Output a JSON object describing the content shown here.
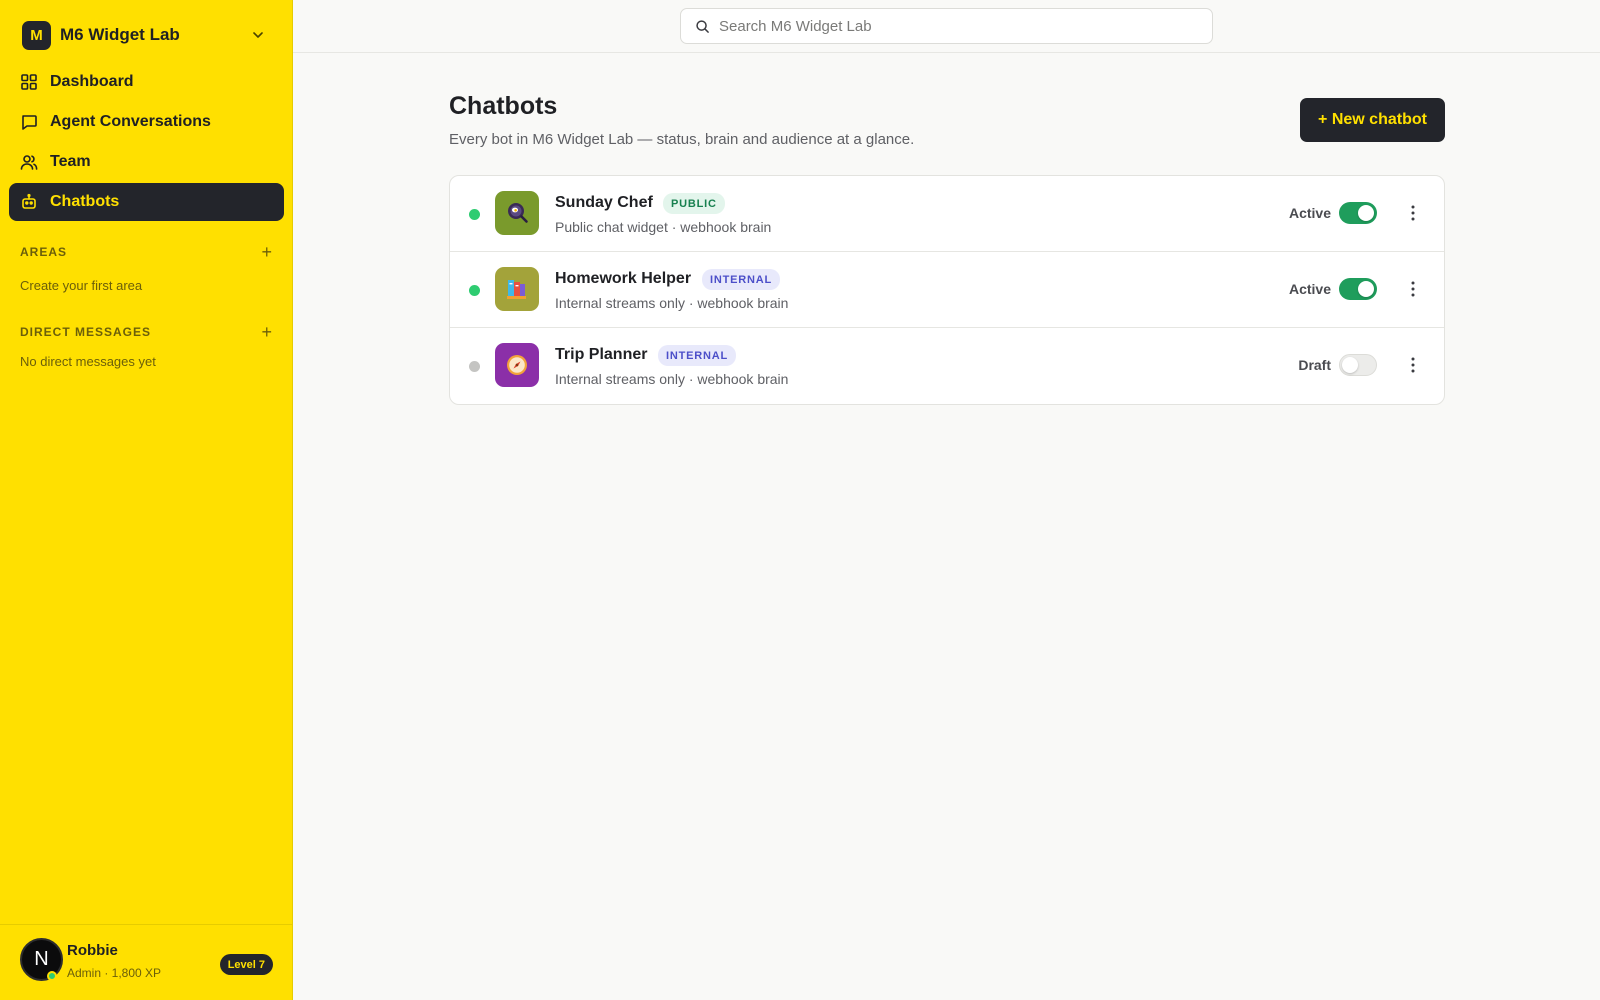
{
  "workspace": {
    "logo_letter": "M",
    "name": "M6 Widget Lab"
  },
  "nav": {
    "items": [
      {
        "label": "Dashboard",
        "icon": "grid-icon"
      },
      {
        "label": "Agent Conversations",
        "icon": "chat-bubble-icon"
      },
      {
        "label": "Team",
        "icon": "users-icon"
      },
      {
        "label": "Chatbots",
        "icon": "bot-icon",
        "active": true
      }
    ]
  },
  "areas": {
    "heading": "AREAS",
    "add": "+",
    "empty": "Create your first area"
  },
  "direct_messages": {
    "heading": "DIRECT MESSAGES",
    "add": "+",
    "empty": "No direct messages yet"
  },
  "user": {
    "avatar_letter": "N",
    "name": "Robbie",
    "meta": "Admin · 1,800 XP",
    "level": "Level 7"
  },
  "search": {
    "placeholder": "Search M6 Widget Lab"
  },
  "page": {
    "title": "Chatbots",
    "subtitle": "Every bot in M6 Widget Lab — status, brain and audience at a glance.",
    "new_button": "+ New chatbot"
  },
  "bots": [
    {
      "name": "Sunday Chef",
      "tag": "PUBLIC",
      "desc": "Public chat widget · webhook brain",
      "status": "Active",
      "enabled": true,
      "icon": "frying-pan-icon",
      "avatar_color": "#7a9a2c",
      "dot_color": "#2ecc71"
    },
    {
      "name": "Homework Helper",
      "tag": "INTERNAL",
      "desc": "Internal streams only · webhook brain",
      "status": "Active",
      "enabled": true,
      "icon": "books-icon",
      "avatar_color": "#a3a33a",
      "dot_color": "#2ecc71"
    },
    {
      "name": "Trip Planner",
      "tag": "INTERNAL",
      "desc": "Internal streams only · webhook brain",
      "status": "Draft",
      "enabled": false,
      "icon": "compass-icon",
      "avatar_color": "#8b2fa8",
      "dot_color": "#c4c4c2"
    }
  ],
  "colors": {
    "sidebar": "#ffe000",
    "dark": "#23252b",
    "active_green": "#1f9d5c",
    "public_tag": "#17804f",
    "internal_tag": "#4c4fc9"
  }
}
